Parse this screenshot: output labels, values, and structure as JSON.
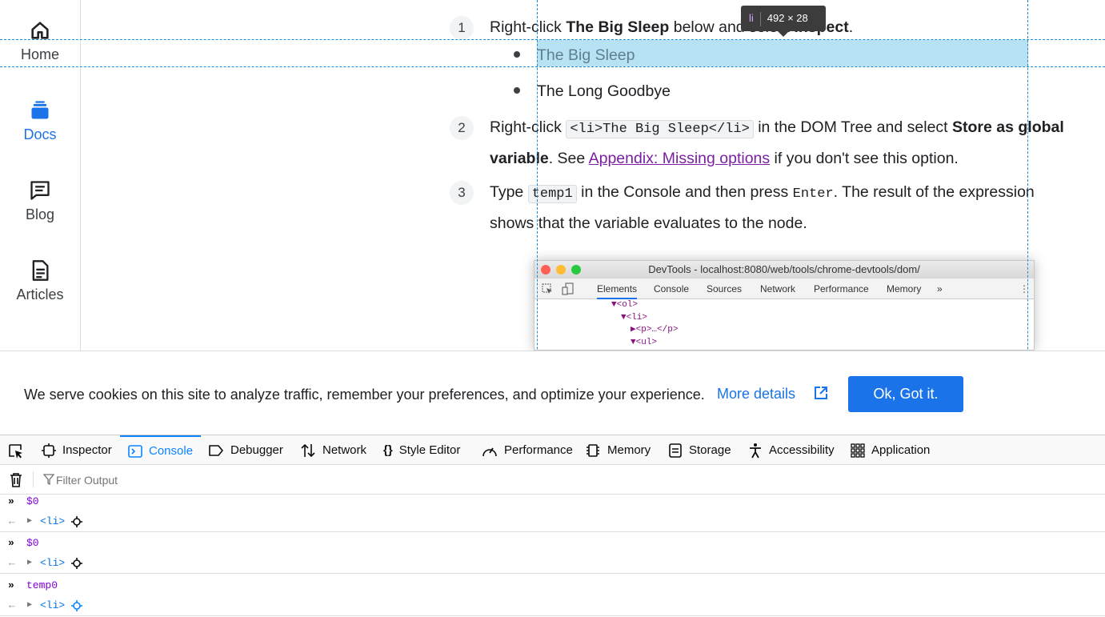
{
  "sidenav": {
    "items": [
      {
        "label": "Home",
        "icon": "home-icon"
      },
      {
        "label": "Docs",
        "icon": "docs-icon",
        "active": true
      },
      {
        "label": "Blog",
        "icon": "blog-icon"
      },
      {
        "label": "Articles",
        "icon": "articles-icon"
      }
    ]
  },
  "steps": [
    {
      "num": "1",
      "pre": "Right-click ",
      "bold": "The Big Sleep",
      "mid": " below and select ",
      "bold2": "Inspect",
      "post": "."
    },
    {
      "num": "2",
      "pre": "Right-click ",
      "code": "<li>The Big Sleep</li>",
      "mid": " in the DOM Tree and select ",
      "bold": "Store as global variable",
      "post1": ". See ",
      "link": "Appendix: Missing options",
      "post2": " if you don't see this option."
    },
    {
      "num": "3",
      "pre": "Type ",
      "code": "temp1",
      "mid": " in the Console and then press ",
      "kbd": "Enter",
      "post": ". The result of the expression shows that the variable evaluates to the node."
    }
  ],
  "list": [
    "The Big Sleep",
    "The Long Goodbye"
  ],
  "tooltip": {
    "tag": "li",
    "size": "492 × 28"
  },
  "screenshot": {
    "title": "DevTools - localhost:8080/web/tools/chrome-devtools/dom/",
    "tabs": [
      "Elements",
      "Console",
      "Sources",
      "Network",
      "Performance",
      "Memory",
      "»"
    ],
    "dom": [
      "▼<ol>",
      "▼<li>",
      "▶<p>…</p>",
      "▼<ul>"
    ]
  },
  "cookie": {
    "text": "We serve cookies on this site to analyze traffic, remember your preferences, and optimize your experience.",
    "more": "More details",
    "ok": "Ok, Got it."
  },
  "devtools": {
    "tabs": [
      "Inspector",
      "Console",
      "Debugger",
      "Network",
      "Style Editor",
      "Performance",
      "Memory",
      "Storage",
      "Accessibility",
      "Application"
    ],
    "active_tab": "Console",
    "filter_placeholder": "Filter Output",
    "console": [
      {
        "input": "$0",
        "output": "<li>"
      },
      {
        "input": "$0",
        "output": "<li>"
      },
      {
        "input": "temp0",
        "output": "<li>"
      }
    ]
  },
  "colors": {
    "accent": "#1a73e8",
    "highlight": "#87ceeb",
    "devtools_accent": "#0a84ff"
  }
}
